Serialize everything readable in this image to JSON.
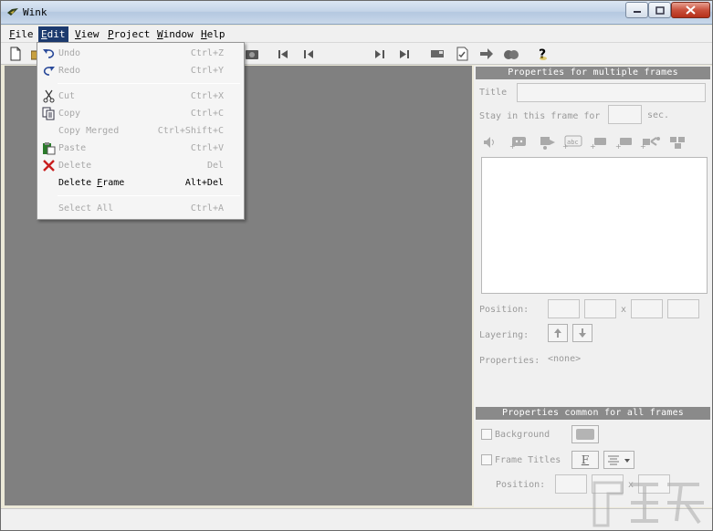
{
  "window": {
    "title": "Wink",
    "colors": {
      "menu_highlight": "#1c3a6e",
      "canvas": "#808080",
      "section_header": "#8a8a8a",
      "close_button": "#c9503c"
    }
  },
  "menubar": {
    "items": [
      {
        "label": "File",
        "mnemonic": "F",
        "rest": "ile"
      },
      {
        "label": "Edit",
        "mnemonic": "E",
        "rest": "dit"
      },
      {
        "label": "View",
        "mnemonic": "V",
        "rest": "iew"
      },
      {
        "label": "Project",
        "mnemonic": "P",
        "rest": "roject"
      },
      {
        "label": "Window",
        "mnemonic": "W",
        "rest": "indow"
      },
      {
        "label": "Help",
        "mnemonic": "H",
        "rest": "elp"
      }
    ]
  },
  "edit_menu": {
    "items": [
      {
        "label": "Undo",
        "shortcut": "Ctrl+Z",
        "enabled": false,
        "icon": "undo-icon"
      },
      {
        "label": "Redo",
        "shortcut": "Ctrl+Y",
        "enabled": false,
        "icon": "redo-icon"
      },
      {
        "label": "Cut",
        "shortcut": "Ctrl+X",
        "enabled": false,
        "icon": "scissors-icon"
      },
      {
        "label": "Copy",
        "shortcut": "Ctrl+C",
        "enabled": false,
        "icon": "copy-icon"
      },
      {
        "label": "Copy Merged",
        "shortcut": "Ctrl+Shift+C",
        "enabled": false,
        "icon": ""
      },
      {
        "label": "Paste",
        "shortcut": "Ctrl+V",
        "enabled": false,
        "icon": "paste-icon"
      },
      {
        "label": "Delete",
        "shortcut": "Del",
        "enabled": false,
        "icon": "delete-x-icon"
      },
      {
        "label": "Delete Frame",
        "shortcut": "Alt+Del",
        "enabled": true,
        "icon": ""
      },
      {
        "label": "Select All",
        "shortcut": "Ctrl+A",
        "enabled": false,
        "icon": ""
      }
    ]
  },
  "toolbar": {
    "icons": [
      "new-file-icon",
      "open-folder-icon",
      "camera-icon",
      "first-frame-icon",
      "previous-frame-icon",
      "next-frame-icon",
      "last-frame-icon",
      "frame-properties-icon",
      "checklist-icon",
      "arrow-right-icon",
      "render-icon",
      "help-icon"
    ]
  },
  "properties_multi": {
    "header": "Properties for multiple frames",
    "title_label": "Title",
    "title_value": "",
    "stay_label": "Stay in this frame for",
    "stay_value": "",
    "stay_unit": "sec.",
    "object_icons": [
      "sound-icon",
      "button-icon",
      "callout-icon",
      "text-box-icon",
      "shape-icon",
      "shape2-icon",
      "link-icon",
      "group-icon"
    ],
    "position_label": "Position:",
    "position_separator": "x",
    "layering_label": "Layering:",
    "properties_label": "Properties:",
    "properties_value": "<none>"
  },
  "properties_all": {
    "header": "Properties common for all frames",
    "background_label": "Background",
    "frame_titles_label": "Frame Titles",
    "font_button_label": "F",
    "position_label": "Position:",
    "position_separator": "x"
  }
}
